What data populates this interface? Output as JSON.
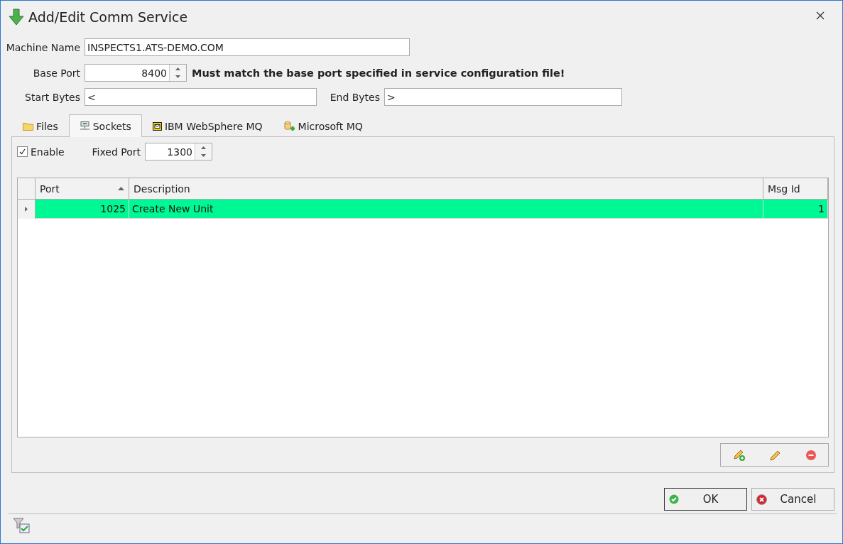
{
  "window": {
    "title": "Add/Edit Comm Service"
  },
  "machine_name": {
    "label": "Machine Name",
    "value": "INSPECTS1.ATS-DEMO.COM"
  },
  "base_port": {
    "label": "Base Port",
    "value": "8400",
    "note": "Must match the base port specified in service configuration file!"
  },
  "start_bytes": {
    "label": "Start Bytes",
    "value": "<"
  },
  "end_bytes": {
    "label": "End Bytes",
    "value": ">"
  },
  "tabs": [
    {
      "label": "Files",
      "kind": "folder",
      "selected": false
    },
    {
      "label": "Sockets",
      "kind": "network",
      "selected": true
    },
    {
      "label": "IBM WebSphere MQ",
      "kind": "mail",
      "selected": false
    },
    {
      "label": "Microsoft MQ",
      "kind": "db",
      "selected": false
    }
  ],
  "enable": {
    "label": "Enable",
    "checked": true
  },
  "fixed_port": {
    "label": "Fixed Port",
    "value": "1300"
  },
  "grid": {
    "columns": [
      {
        "label": "Port",
        "sorted": true
      },
      {
        "label": "Description",
        "sorted": false
      },
      {
        "label": "Msg Id",
        "sorted": false
      }
    ],
    "rows": [
      {
        "port": "1025",
        "description": "Create New Unit",
        "msg_id": "1",
        "selected": true
      }
    ]
  },
  "buttons": [
    {
      "label": "OK",
      "kind": "ok",
      "default": true
    },
    {
      "label": "Cancel",
      "kind": "cancel",
      "default": false
    }
  ]
}
